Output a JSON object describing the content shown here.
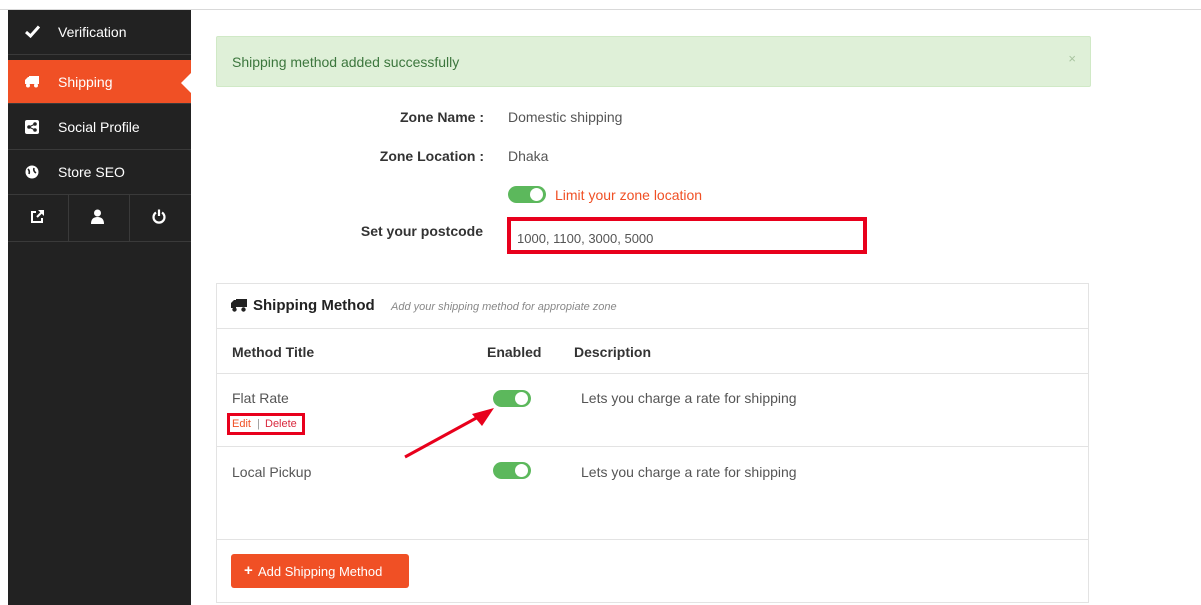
{
  "sidebar": {
    "items": [
      {
        "label": "Verification",
        "icon": "check-icon"
      },
      {
        "label": "Shipping",
        "icon": "truck-icon"
      },
      {
        "label": "Social Profile",
        "icon": "share-icon"
      },
      {
        "label": "Store SEO",
        "icon": "globe-icon"
      }
    ],
    "bottom_icons": [
      "external-link-icon",
      "user-icon",
      "power-icon"
    ]
  },
  "alert": {
    "message": "Shipping method added successfully",
    "close": "×"
  },
  "zone": {
    "name_label": "Zone Name :",
    "name_value": "Domestic shipping",
    "location_label": "Zone Location :",
    "location_value": "Dhaka",
    "limit_label": "Limit your zone location",
    "postcode_label": "Set your postcode",
    "postcode_value": "1000, 1100, 3000, 5000"
  },
  "shipping": {
    "title": "Shipping Method",
    "subtitle": "Add your shipping method for appropiate zone",
    "columns": {
      "title": "Method Title",
      "enabled": "Enabled",
      "description": "Description"
    },
    "rows": [
      {
        "title": "Flat Rate",
        "enabled": true,
        "description": "Lets you charge a rate for shipping",
        "edit": "Edit",
        "sep": "|",
        "delete": "Delete"
      },
      {
        "title": "Local Pickup",
        "enabled": true,
        "description": "Lets you charge a rate for shipping"
      }
    ],
    "add_label": "Add Shipping Method",
    "add_icon": "+"
  },
  "colors": {
    "accent": "#f05025",
    "toggle": "#5cb85c",
    "highlight": "#e8001c",
    "sidebar": "#222222"
  }
}
